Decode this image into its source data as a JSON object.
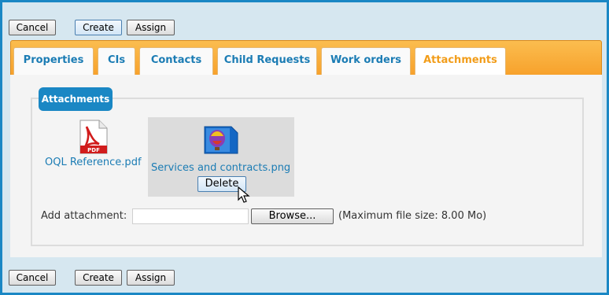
{
  "toolbar_top": {
    "cancel": "Cancel",
    "create": "Create",
    "assign": "Assign"
  },
  "toolbar_bottom": {
    "cancel": "Cancel",
    "create": "Create",
    "assign": "Assign"
  },
  "tabs": [
    {
      "label": "Properties"
    },
    {
      "label": "CIs"
    },
    {
      "label": "Contacts"
    },
    {
      "label": "Child Requests"
    },
    {
      "label": "Work orders"
    },
    {
      "label": "Attachments",
      "active": true
    }
  ],
  "attachments_section": {
    "legend": "Attachments",
    "files": [
      {
        "name": "OQL Reference.pdf",
        "icon": "pdf-icon"
      },
      {
        "name": "Services and contracts.png",
        "icon": "image-icon"
      }
    ],
    "delete_label": "Delete",
    "add_label": "Add attachment:",
    "file_input_value": "",
    "browse_label": "Browse...",
    "max_size_text": "(Maximum file size: 8.00 Mo)"
  },
  "colors": {
    "accent_blue": "#1a87c4",
    "tab_orange": "#f7a12b",
    "active_tab_text": "#f29d1a"
  }
}
